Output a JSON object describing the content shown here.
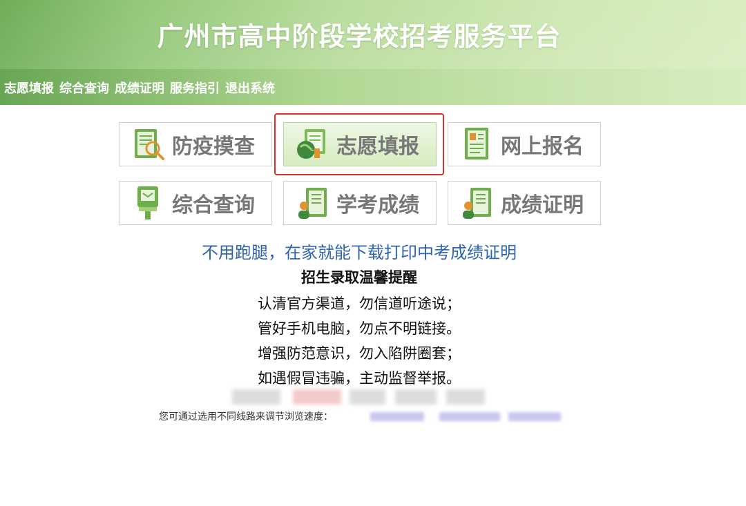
{
  "header": {
    "title": "广州市高中阶段学校招考服务平台"
  },
  "nav": {
    "items": [
      "志愿填报",
      "综合查询",
      "成绩证明",
      "服务指引",
      "退出系统"
    ]
  },
  "tiles": [
    {
      "label": "防疫摸查",
      "icon": "magnifier-document-icon"
    },
    {
      "label": "志愿填报",
      "icon": "globe-folder-icon"
    },
    {
      "label": "网上报名",
      "icon": "id-card-document-icon"
    },
    {
      "label": "综合查询",
      "icon": "kiosk-terminal-icon"
    },
    {
      "label": "学考成绩",
      "icon": "person-document-icon"
    },
    {
      "label": "成绩证明",
      "icon": "person-certificate-icon"
    }
  ],
  "notice": {
    "headline": "不用跑腿，在家就能下载打印中考成绩证明",
    "reminder_title": "招生录取温馨提醒",
    "reminder_lines": [
      "认清官方渠道，勿信道听途说；",
      "管好手机电脑，勿点不明链接。",
      "增强防范意识，勿入陷阱圈套；",
      "如遇假冒违骗，主动监督举报。"
    ]
  },
  "speed": {
    "label": "您可通过选用不同线路来调节浏览速度："
  },
  "colors": {
    "accent_green": "#93c77a",
    "headline_blue": "#2f64b0",
    "highlight_red": "#e02b2b"
  }
}
